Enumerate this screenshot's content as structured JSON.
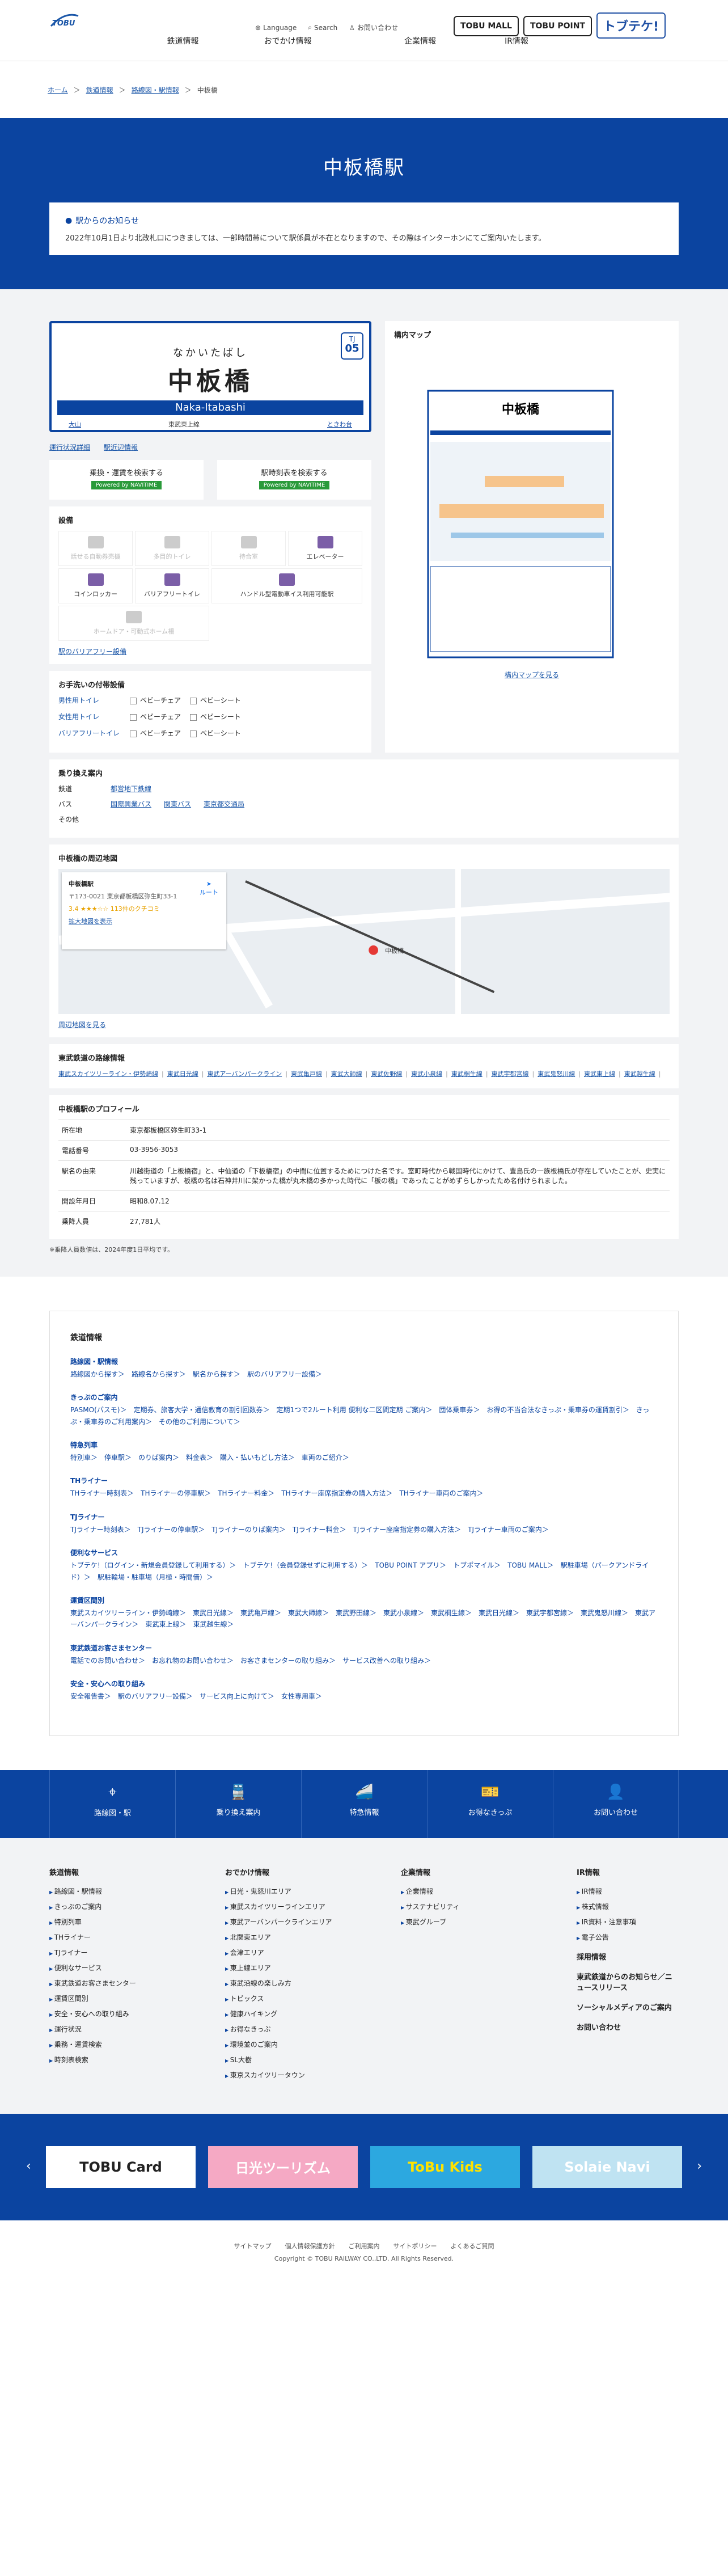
{
  "header": {
    "logo_text": "TOBU",
    "nav": [
      "鉄道情報",
      "おでかけ情報",
      "企業情報",
      "IR情報"
    ],
    "ir_sub": "IR情報",
    "utils": [
      "Language",
      "Search",
      "お問い合わせ"
    ],
    "brands": [
      "TOBU MALL",
      "TOBU POINT",
      "トブテケ!"
    ]
  },
  "breadcrumb": [
    "ホーム",
    "鉄道情報",
    "路線図・駅情報",
    "中板橋"
  ],
  "hero": {
    "title": "中板橋駅",
    "notice_title": "駅からのお知らせ",
    "notice_body": "2022年10月1日より北改札口につきましては、一部時間帯について駅係員が不在となりますので、その際はインターホンにてご案内いたします。"
  },
  "station": {
    "kana": "なかいたばし",
    "kanji": "中板橋",
    "roman": "Naka-Itabashi",
    "code_line": "TJ",
    "code_num": "05",
    "prev": "大山",
    "line": "東武東上線",
    "next": "ときわ台",
    "link_timetable": "運行状況詳細",
    "link_train": "駅近辺情報",
    "navi1": "乗換・運賃を検索する",
    "navi2": "駅時刻表を検索する",
    "navi_power": "Powered by NAVITIME"
  },
  "map_panel": {
    "title": "構内マップ",
    "link": "構内マップを見る",
    "map_title": "中板橋"
  },
  "facilities": {
    "title": "設備",
    "items": [
      {
        "label": "話せる自動券売機",
        "on": false
      },
      {
        "label": "多目的トイレ",
        "on": false
      },
      {
        "label": "待合室",
        "on": false
      },
      {
        "label": "エレベーター",
        "on": true
      },
      {
        "label": "コインロッカー",
        "on": true
      },
      {
        "label": "バリアフリートイレ",
        "on": true
      },
      {
        "label": "ハンドル型電動車イス利用可能駅",
        "on": true
      },
      {
        "label": "ホームドア・可動式ホーム柵",
        "on": false
      }
    ],
    "link": "駅のバリアフリー設備"
  },
  "toilet": {
    "title": "お手洗いの付帯設備",
    "rows": [
      {
        "label": "男性用トイレ",
        "opt1": "ベビーチェア",
        "opt2": "ベビーシート"
      },
      {
        "label": "女性用トイレ",
        "opt1": "ベビーチェア",
        "opt2": "ベビーシート"
      },
      {
        "label": "バリアフリートイレ",
        "opt1": "ベビーチェア",
        "opt2": "ベビーシート"
      }
    ]
  },
  "transfer": {
    "title": "乗り換え案内",
    "rows": [
      {
        "label": "鉄道",
        "links": [
          "都営地下鉄線"
        ]
      },
      {
        "label": "バス",
        "links": [
          "国際興業バス",
          "関東バス",
          "東京都交通局"
        ]
      },
      {
        "label": "その他",
        "links": []
      }
    ]
  },
  "nearby": {
    "title": "中板橋の周辺地図",
    "card_title": "中板橋駅",
    "card_addr": "〒173-0021 東京都板橋区弥生町33-1",
    "card_rating": "3.4 ★★★☆☆ 113件のクチコミ",
    "card_link": "拡大地図を表示",
    "card_route": "ルート",
    "pin_label": "中板橋",
    "footer_link": "周辺地図を見る"
  },
  "lines": {
    "title": "東武鉄道の路線情報",
    "items": [
      "東武スカイツリーライン・伊勢崎線",
      "東武日光線",
      "東武アーバンパークライン",
      "東武亀戸線",
      "東武大師線",
      "東武佐野線",
      "東武小泉線",
      "東武桐生線",
      "東武宇都宮線",
      "東武鬼怒川線",
      "東武東上線",
      "東武越生線"
    ]
  },
  "profile": {
    "title": "中板橋駅のプロフィール",
    "rows": [
      {
        "k": "所在地",
        "v": "東京都板橋区弥生町33-1"
      },
      {
        "k": "電話番号",
        "v": "03-3956-3053"
      },
      {
        "k": "駅名の由来",
        "v": "川越街道の「上板橋宿」と、中仙道の「下板橋宿」の中間に位置するためにつけた名です。室町時代から戦国時代にかけて、豊島氏の一族板橋氏が存在していたことが、史実に残っていますが、板橋の名は石神井川に架かった橋が丸木橋の多かった時代に「板の橋」であったことがめずらしかったため名付けられました。"
      },
      {
        "k": "開設年月日",
        "v": "昭和8.07.12"
      },
      {
        "k": "乗降人員",
        "v": "27,781人"
      }
    ],
    "note": "※乗降人員数値は、2024年度1日平均です。"
  },
  "index": {
    "title": "鉄道情報",
    "groups": [
      {
        "t": "路線図・駅情報",
        "l": "路線図から探す＞　路線名から探す＞　駅名から探す＞　駅のバリアフリー設備＞"
      },
      {
        "t": "きっぷのご案内",
        "l": "PASMO(パスモ)＞　定期券、旅客大学・通信教育の割引回数券＞　定期1つで2ルート利用 便利な二区間定期 ご案内＞　団体乗車券＞　お得の不当合法なきっぷ・乗車券の運賃割引＞　きっぷ・乗車券のご利用案内＞　その他のご利用について＞"
      },
      {
        "t": "特急列車",
        "l": "特別車＞　停車駅＞　のりば案内＞　料金表＞　購入・払いもどし方法＞　車両のご紹介＞"
      },
      {
        "t": "THライナー",
        "l": "THライナー時刻表＞　THライナーの停車駅＞　THライナー料金＞　THライナー座席指定券の購入方法＞　THライナー車両のご案内＞"
      },
      {
        "t": "TJライナー",
        "l": "TJライナー時刻表＞　TJライナーの停車駅＞　TJライナーのりば案内＞　TJライナー料金＞　TJライナー座席指定券の購入方法＞　TJライナー車両のご案内＞"
      },
      {
        "t": "便利なサービス",
        "l": "トブテケ!（ログイン・新規会員登録して利用する）＞　トブテケ!（会員登録せずに利用する）＞　TOBU POINT アプリ＞　トブポマイル＞　TOBU MALL＞　駅駐車場（パークアンドライド）＞　駅駐輪場・駐車場（月極・時間借）＞"
      },
      {
        "t": "運賃区間別",
        "l": "東武スカイツリーライン・伊勢崎線＞　東武日光線＞　東武亀戸線＞　東武大師線＞　東武野田線＞　東武小泉線＞　東武桐生線＞　東武日光線＞　東武宇都宮線＞　東武鬼怒川線＞　東武アーバンパークライン＞　東武東上線＞　東武越生線＞"
      },
      {
        "t": "東武鉄道お客さまセンター",
        "l": "電話でのお問い合わせ＞　お忘れ物のお問い合わせ＞　お客さまセンターの取り組み＞　サービス改善への取り組み＞"
      },
      {
        "t": "安全・安心への取り組み",
        "l": "安全報告書＞　駅のバリアフリー設備＞　サービス向上に向けて＞　女性専用車＞"
      }
    ]
  },
  "bluebar": [
    {
      "icon": "⌖",
      "label": "路線図・駅"
    },
    {
      "icon": "🚆",
      "label": "乗り換え案内"
    },
    {
      "icon": "🚄",
      "label": "特急情報"
    },
    {
      "icon": "🎫",
      "label": "お得なきっぷ"
    },
    {
      "icon": "👤",
      "label": "お問い合わせ"
    }
  ],
  "footer": {
    "cols": [
      {
        "h": "鉄道情報",
        "items": [
          "路線図・駅情報",
          "きっぷのご案内",
          "特別列車",
          "THライナー",
          "TJライナー",
          "便利なサービス",
          "東武鉄道お客さまセンター",
          "運賃区間別",
          "安全・安心への取り組み",
          "運行状況",
          "乗務・運賃検索",
          "時刻表検索"
        ]
      },
      {
        "h": "おでかけ情報",
        "items": [
          "日光・鬼怒川エリア",
          "東武スカイツリーラインエリア",
          "東武アーバンパークラインエリア",
          "北関東エリア",
          "会津エリア",
          "東上線エリア",
          "東武沿線の楽しみ方",
          "トピックス",
          "健康ハイキング",
          "お得なきっぷ",
          "環境並のご案内",
          "SL大樹",
          "東京スカイツリータウン"
        ]
      },
      {
        "h": "企業情報",
        "items": [
          "企業情報",
          "サステナビリティ",
          "東武グループ"
        ]
      },
      {
        "h": "IR情報",
        "items": [
          "IR情報",
          "株式情報",
          "IR資料・注意事項",
          "電子公告"
        ],
        "bigs": [
          "採用情報",
          "東武鉄道からのお知らせ／ニュースリリース",
          "ソーシャルメディアのご案内",
          "お問い合わせ"
        ]
      }
    ]
  },
  "banners": [
    "TOBU Card",
    "日光ツーリズム",
    "ToBu Kids",
    "Solaie Navi"
  ],
  "copyright": {
    "links": [
      "サイトマップ",
      "個人情報保護方針",
      "ご利用案内",
      "サイトポリシー",
      "よくあるご質問"
    ],
    "text": "Copyright © TOBU RAILWAY CO.,LTD. All Rights Reserved."
  }
}
